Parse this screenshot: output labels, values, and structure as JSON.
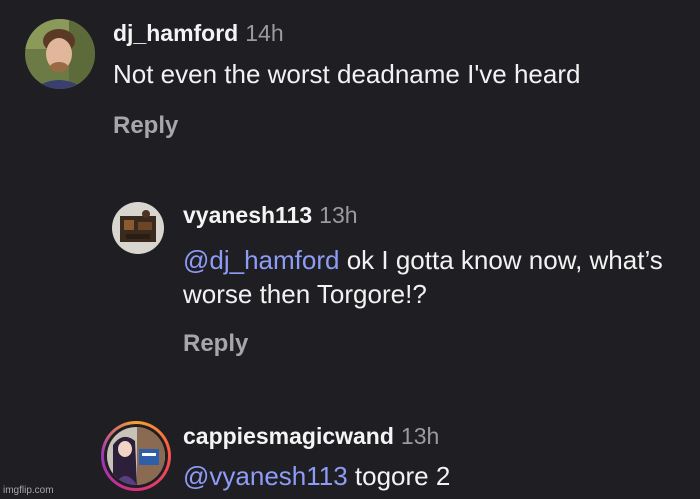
{
  "comments": [
    {
      "username": "dj_hamford",
      "time": "14h",
      "text": "Not even the worst deadname I've heard",
      "reply_label": "Reply"
    },
    {
      "username": "vyanesh113",
      "time": "13h",
      "mention": "@dj_hamford",
      "text": " ok I gotta know now, what’s worse then Torgore!?",
      "reply_label": "Reply"
    },
    {
      "username": "cappiesmagicwand",
      "time": "13h",
      "mention": "@vyanesh113",
      "text": " togore 2"
    }
  ],
  "watermark": "imgflip.com",
  "colors": {
    "background": "#1e1e23",
    "mention": "#8e9cf5",
    "muted": "#9a9a9f"
  }
}
